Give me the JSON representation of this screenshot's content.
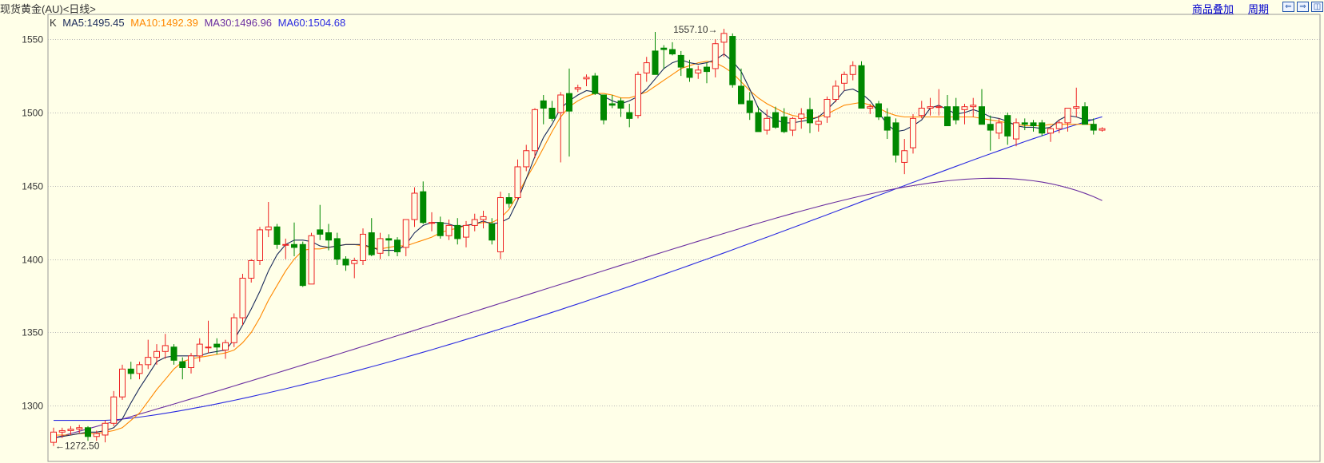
{
  "header": {
    "title": "现货黄金(AU)<日线>",
    "overlay_link": "商品叠加",
    "period_link": "周期",
    "nav_left": "⇐",
    "nav_right": "⇒",
    "nav_window": "◫"
  },
  "legend": {
    "k": "K",
    "ma5": "MA5:1495.45",
    "ma10": "MA10:1492.39",
    "ma30": "MA30:1496.96",
    "ma60": "MA60:1504.68"
  },
  "colors": {
    "up": "#ee2222",
    "down": "#008800",
    "ma5": "#1a2a5a",
    "ma10": "#ff8800",
    "ma30": "#6a2ea0",
    "ma60": "#2a2ae0",
    "grid": "#b8b8b8",
    "background": "#ffffe8"
  },
  "chart_data": {
    "type": "candlestick",
    "title": "现货黄金(AU)<日线>",
    "ylim": [
      1262,
      1567
    ],
    "yticks": [
      1300,
      1350,
      1400,
      1450,
      1500,
      1550
    ],
    "grid": true,
    "max_annotation": {
      "label": "1557.10",
      "value": 1557.1
    },
    "min_annotation": {
      "label": "1272.50",
      "value": 1272.5
    },
    "ohlc": [
      [
        1275,
        1285,
        1272.5,
        1282
      ],
      [
        1282,
        1285,
        1278,
        1283
      ],
      [
        1283,
        1286,
        1280,
        1284
      ],
      [
        1284,
        1287,
        1281,
        1285
      ],
      [
        1285,
        1286,
        1276,
        1279
      ],
      [
        1279,
        1283,
        1276,
        1281
      ],
      [
        1280,
        1290,
        1275,
        1288
      ],
      [
        1288,
        1310,
        1286,
        1306
      ],
      [
        1306,
        1328,
        1304,
        1325
      ],
      [
        1325,
        1330,
        1318,
        1322
      ],
      [
        1322,
        1330,
        1318,
        1328
      ],
      [
        1328,
        1345,
        1325,
        1333
      ],
      [
        1333,
        1342,
        1328,
        1337
      ],
      [
        1337,
        1349,
        1332,
        1341
      ],
      [
        1340,
        1342,
        1328,
        1331
      ],
      [
        1330,
        1333,
        1318,
        1326
      ],
      [
        1326,
        1336,
        1322,
        1334
      ],
      [
        1334,
        1346,
        1330,
        1342
      ],
      [
        1340,
        1358,
        1336,
        1340
      ],
      [
        1342,
        1346,
        1335,
        1340
      ],
      [
        1338,
        1345,
        1332,
        1343
      ],
      [
        1343,
        1363,
        1340,
        1360
      ],
      [
        1360,
        1390,
        1355,
        1387
      ],
      [
        1387,
        1400,
        1384,
        1399
      ],
      [
        1399,
        1422,
        1396,
        1420
      ],
      [
        1420,
        1439,
        1415,
        1422
      ],
      [
        1422,
        1424,
        1407,
        1410
      ],
      [
        1410,
        1414,
        1400,
        1410
      ],
      [
        1410,
        1425,
        1402,
        1408
      ],
      [
        1410,
        1412,
        1381,
        1382
      ],
      [
        1383,
        1418,
        1383,
        1416
      ],
      [
        1420,
        1437,
        1413,
        1417
      ],
      [
        1418,
        1424,
        1406,
        1413
      ],
      [
        1414,
        1418,
        1396,
        1400
      ],
      [
        1400,
        1402,
        1392,
        1396
      ],
      [
        1397,
        1401,
        1387,
        1399
      ],
      [
        1399,
        1421,
        1396,
        1417
      ],
      [
        1418,
        1428,
        1402,
        1403
      ],
      [
        1404,
        1418,
        1400,
        1414
      ],
      [
        1414,
        1417,
        1402,
        1413
      ],
      [
        1413,
        1415,
        1402,
        1405
      ],
      [
        1408,
        1427,
        1402,
        1427
      ],
      [
        1427,
        1449,
        1422,
        1445
      ],
      [
        1446,
        1453,
        1424,
        1425
      ],
      [
        1425,
        1432,
        1419,
        1425
      ],
      [
        1425,
        1429,
        1414,
        1416
      ],
      [
        1416,
        1427,
        1413,
        1423
      ],
      [
        1423,
        1428,
        1410,
        1414
      ],
      [
        1415,
        1426,
        1408,
        1423
      ],
      [
        1423,
        1431,
        1419,
        1427
      ],
      [
        1427,
        1433,
        1421,
        1429
      ],
      [
        1424,
        1428,
        1410,
        1413
      ],
      [
        1405,
        1446,
        1400,
        1442
      ],
      [
        1442,
        1445,
        1435,
        1438
      ],
      [
        1442,
        1468,
        1440,
        1463
      ],
      [
        1463,
        1478,
        1460,
        1474
      ],
      [
        1474,
        1503,
        1469,
        1502
      ],
      [
        1508,
        1512,
        1492,
        1503
      ],
      [
        1503,
        1508,
        1494,
        1496
      ],
      [
        1500,
        1514,
        1466,
        1512
      ],
      [
        1513,
        1530,
        1470,
        1501
      ],
      [
        1516,
        1519,
        1514,
        1517
      ],
      [
        1523,
        1526,
        1518,
        1524
      ],
      [
        1525,
        1527,
        1512,
        1513
      ],
      [
        1512,
        1512,
        1492,
        1495
      ],
      [
        1506,
        1512,
        1503,
        1505
      ],
      [
        1508,
        1510,
        1497,
        1503
      ],
      [
        1500,
        1506,
        1490,
        1496
      ],
      [
        1498,
        1528,
        1496,
        1526
      ],
      [
        1527,
        1538,
        1521,
        1534
      ],
      [
        1542,
        1555,
        1526,
        1526
      ],
      [
        1544,
        1546,
        1530,
        1543
      ],
      [
        1543,
        1548,
        1539,
        1540
      ],
      [
        1539,
        1542,
        1525,
        1531
      ],
      [
        1530,
        1536,
        1521,
        1524
      ],
      [
        1527,
        1532,
        1523,
        1529
      ],
      [
        1531,
        1534,
        1520,
        1528
      ],
      [
        1530,
        1550,
        1524,
        1547
      ],
      [
        1548,
        1557.1,
        1538,
        1554
      ],
      [
        1552,
        1554,
        1517,
        1519
      ],
      [
        1518,
        1530,
        1508,
        1506
      ],
      [
        1508,
        1514,
        1495,
        1500
      ],
      [
        1500,
        1504,
        1488,
        1487
      ],
      [
        1488,
        1502,
        1485,
        1496
      ],
      [
        1500,
        1504,
        1489,
        1490
      ],
      [
        1497,
        1503,
        1486,
        1487
      ],
      [
        1488,
        1497,
        1484,
        1496
      ],
      [
        1496,
        1503,
        1489,
        1499
      ],
      [
        1502,
        1510,
        1486,
        1493
      ],
      [
        1492,
        1498,
        1487,
        1494
      ],
      [
        1497,
        1511,
        1493,
        1509
      ],
      [
        1509,
        1522,
        1507,
        1518
      ],
      [
        1520,
        1528,
        1515,
        1526
      ],
      [
        1526,
        1535,
        1522,
        1532
      ],
      [
        1532,
        1535,
        1509,
        1503
      ],
      [
        1503,
        1506,
        1499,
        1504
      ],
      [
        1506,
        1508,
        1495,
        1497
      ],
      [
        1497,
        1503,
        1482,
        1488
      ],
      [
        1493,
        1496,
        1466,
        1471
      ],
      [
        1466,
        1482,
        1458,
        1474
      ],
      [
        1476,
        1499,
        1472,
        1496
      ],
      [
        1498,
        1508,
        1496,
        1503
      ],
      [
        1503,
        1510,
        1498,
        1504
      ],
      [
        1504,
        1516,
        1498,
        1504
      ],
      [
        1504,
        1512,
        1495,
        1491
      ],
      [
        1504,
        1510,
        1492,
        1495
      ],
      [
        1502,
        1506,
        1492,
        1504
      ],
      [
        1504,
        1510,
        1497,
        1505
      ],
      [
        1504,
        1516,
        1497,
        1492
      ],
      [
        1492,
        1498,
        1474,
        1488
      ],
      [
        1486,
        1496,
        1482,
        1493
      ],
      [
        1498,
        1500,
        1478,
        1484
      ],
      [
        1482,
        1496,
        1477,
        1493
      ],
      [
        1493,
        1496,
        1488,
        1492
      ],
      [
        1493,
        1495,
        1487,
        1491
      ],
      [
        1493,
        1495,
        1484,
        1486
      ],
      [
        1486,
        1491,
        1480,
        1489
      ],
      [
        1489,
        1495,
        1486,
        1493
      ],
      [
        1493,
        1503,
        1487,
        1503
      ],
      [
        1503,
        1517,
        1497,
        1504
      ],
      [
        1504,
        1507,
        1492,
        1492
      ],
      [
        1492,
        1496,
        1485,
        1488
      ],
      [
        1488,
        1490,
        1487,
        1489
      ]
    ],
    "ma5": [
      1278,
      1279,
      1280,
      1281,
      1282,
      1282,
      1283,
      1285,
      1291,
      1302,
      1312,
      1321,
      1330,
      1333,
      1334,
      1334,
      1334,
      1334,
      1336,
      1337,
      1338,
      1345,
      1355,
      1366,
      1378,
      1392,
      1403,
      1410,
      1413,
      1413,
      1412,
      1409,
      1408,
      1409,
      1410,
      1410,
      1410,
      1408,
      1406,
      1406,
      1406,
      1410,
      1418,
      1423,
      1425,
      1425,
      1424,
      1422,
      1423,
      1424,
      1426,
      1424,
      1425,
      1428,
      1440,
      1455,
      1470,
      1483,
      1492,
      1503,
      1508,
      1512,
      1515,
      1514,
      1511,
      1508,
      1506,
      1508,
      1511,
      1516,
      1523,
      1530,
      1534,
      1536,
      1534,
      1533,
      1534,
      1536,
      1540,
      1535,
      1528,
      1516,
      1503,
      1498,
      1495,
      1493,
      1493,
      1494,
      1495,
      1497,
      1502,
      1508,
      1515,
      1516,
      1513,
      1508,
      1500,
      1492,
      1487,
      1488,
      1491,
      1495,
      1503,
      1505,
      1502,
      1499,
      1500,
      1502,
      1500,
      1497,
      1496,
      1494,
      1491,
      1490,
      1490,
      1489,
      1490,
      1495,
      1498,
      1497,
      1495,
      1495
    ],
    "ma10": [
      1280,
      1280,
      1280,
      1281,
      1281,
      1281,
      1282,
      1283,
      1285,
      1290,
      1295,
      1303,
      1311,
      1318,
      1325,
      1330,
      1332,
      1333,
      1334,
      1335,
      1336,
      1338,
      1343,
      1350,
      1360,
      1372,
      1382,
      1392,
      1400,
      1406,
      1407,
      1407,
      1408,
      1409,
      1410,
      1410,
      1409,
      1408,
      1407,
      1408,
      1409,
      1409,
      1411,
      1413,
      1415,
      1418,
      1420,
      1421,
      1423,
      1424,
      1425,
      1425,
      1428,
      1434,
      1444,
      1455,
      1465,
      1476,
      1487,
      1497,
      1504,
      1508,
      1511,
      1513,
      1513,
      1512,
      1510,
      1510,
      1512,
      1514,
      1518,
      1522,
      1526,
      1530,
      1532,
      1534,
      1535,
      1534,
      1531,
      1527,
      1521,
      1515,
      1510,
      1506,
      1503,
      1500,
      1498,
      1497,
      1496,
      1497,
      1499,
      1502,
      1505,
      1506,
      1507,
      1505,
      1503,
      1500,
      1498,
      1497,
      1497,
      1497,
      1497,
      1497,
      1497,
      1497,
      1497,
      1497,
      1496,
      1495,
      1494,
      1493,
      1492,
      1491,
      1491,
      1491,
      1492,
      1492,
      1492,
      1492,
      1492,
      1492
    ]
  }
}
